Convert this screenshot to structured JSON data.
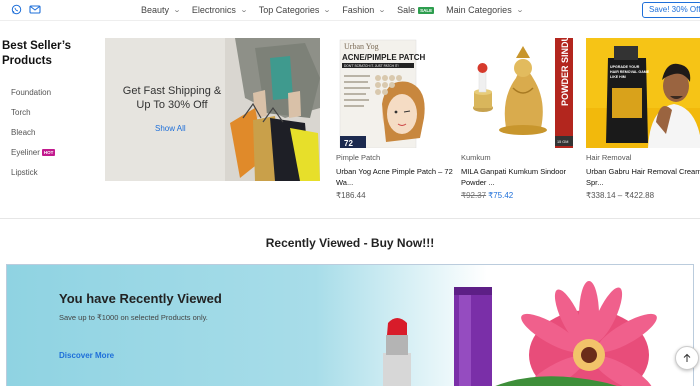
{
  "nav": {
    "items": [
      {
        "label": "Beauty",
        "has_chevron": true
      },
      {
        "label": "Electronics",
        "has_chevron": true
      },
      {
        "label": "Top Categories",
        "has_chevron": true
      },
      {
        "label": "Fashion",
        "has_chevron": true
      },
      {
        "label": "Sale",
        "badge": "SALE",
        "has_chevron": false
      },
      {
        "label": "Main Categories",
        "has_chevron": true
      }
    ],
    "promo_button": "Save! 30% Off",
    "social_icons": [
      "whatsapp-icon",
      "mail-icon"
    ]
  },
  "best_sellers": {
    "title": "Best Seller’s Products",
    "items": [
      {
        "label": "Foundation"
      },
      {
        "label": "Torch"
      },
      {
        "label": "Bleach"
      },
      {
        "label": "Eyeliner",
        "badge": "HOT"
      },
      {
        "label": "Lipstick"
      }
    ]
  },
  "banner": {
    "headline": "Get Fast Shipping & Up To 30% Off",
    "link": "Show All"
  },
  "products": [
    {
      "category": "Pimple Patch",
      "name": "Urban Yog Acne Pimple Patch – 72 Wa...",
      "price": "₹186.44",
      "image_text": {
        "brand": "Urban Yog",
        "title": "ACNE/PIMPLE PATCH",
        "tagline": "DON'T SCRATCH IT. JUST PATCH IT!",
        "count": "72"
      }
    },
    {
      "category": "Kumkum",
      "name": "MILA Ganpati Kumkum Sindoor Powder ...",
      "old_price": "₹92.37",
      "new_price": "₹75.42",
      "image_text": {
        "side_label": "POWDER SINDUR",
        "weight": "15 GM"
      }
    },
    {
      "category": "Hair Removal",
      "name": "Urban Gabru Hair Removal Cream Spr...",
      "price": "₹338.14 – ₹422.88",
      "image_text": {
        "line1": "UPGRADE YOUR",
        "line2": "HAIR REMOVAL GAME",
        "line3": "LIKE HIM"
      }
    }
  ],
  "section_title": "Recently Viewed - Buy Now!!!",
  "recently_viewed": {
    "title": "You have Recently Viewed",
    "subtitle": "Save up to ₹1000 on selected Products only.",
    "link": "Discover More"
  },
  "colors": {
    "accent": "#1e6fd9",
    "sale_badge": "#2e9e4f",
    "hot_badge": "#c21a8e",
    "rv_bg": "#a8dde9"
  }
}
